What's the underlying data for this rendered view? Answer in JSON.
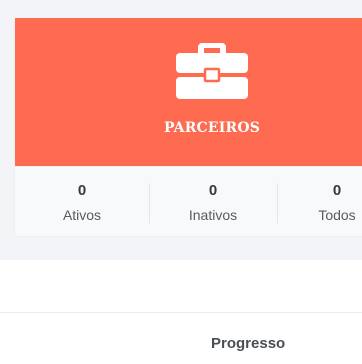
{
  "card": {
    "icon": "briefcase-icon",
    "title": "PARCEIROS",
    "accent_color": "#ff6b50",
    "stats": [
      {
        "value": "0",
        "label": "Ativos"
      },
      {
        "value": "0",
        "label": "Inativos"
      },
      {
        "value": "0",
        "label": "Todos"
      }
    ]
  },
  "table": {
    "columns": [
      "Progresso"
    ]
  }
}
